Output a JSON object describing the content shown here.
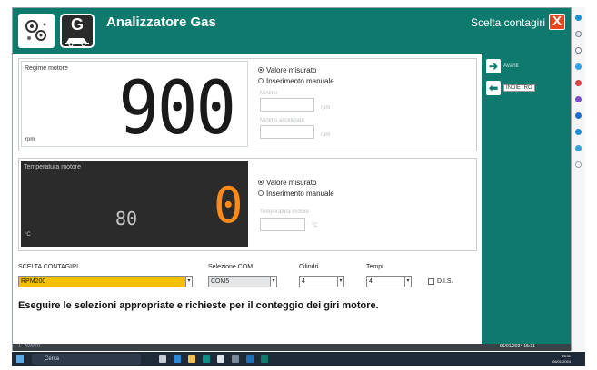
{
  "header": {
    "app_title": "Analizzatore Gas",
    "logo_letter": "G",
    "gauge_selection": "Scelta contagiri",
    "close_symbol": "X"
  },
  "side": {
    "next_label": "Avanti",
    "back_label": "INDIETRO"
  },
  "engine_rpm": {
    "title": "Regime motore",
    "value": "900",
    "unit": "rpm",
    "option_measured": "Valore misurato",
    "option_manual": "Inserimento manuale",
    "selected_option": "Valore misurato",
    "min_label": "Minimo",
    "accel_label": "Minimo accelerato",
    "rpm_unit": "rpm"
  },
  "engine_temp": {
    "title": "Temperatura motore",
    "secondary_value": "80",
    "value": "0",
    "unit": "°C",
    "option_measured": "Valore misurato",
    "option_manual": "Inserimento manuale",
    "selected_option": "Valore misurato",
    "temp_label": "Temperatura motore",
    "temp_unit": "°C"
  },
  "selection": {
    "gauge_label": "SCELTA CONTAGIRI",
    "gauge_value": "RPM200",
    "com_label": "Selezione COM",
    "com_value": "COM5",
    "cylinders_label": "Cilindri",
    "cylinders_value": "4",
    "strokes_label": "Tempi",
    "strokes_value": "4",
    "dis_label": "D.I.S."
  },
  "message": "Eseguire le selezioni appropriate e richieste per il conteggio dei giri motore.",
  "status": {
    "left": "1 - AVANTI",
    "datetime": "06/01/2024  15:31"
  },
  "taskbar": {
    "search_placeholder": "Cerca",
    "time": "15:31",
    "date": "06/01/2024"
  },
  "colors": {
    "title_bar": "#0e7a6e",
    "temp_digit": "#ff8a1a",
    "gauge_combo": "#f5c000",
    "close_button": "#e8441f"
  }
}
